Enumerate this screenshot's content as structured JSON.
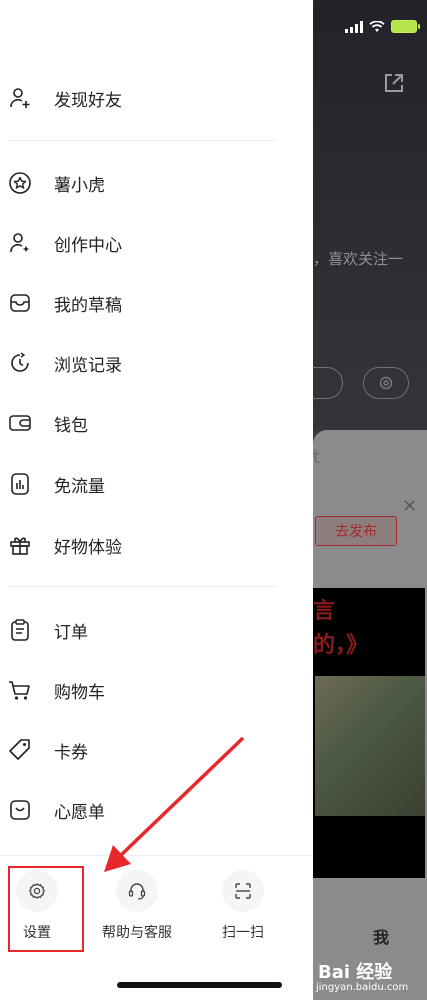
{
  "drawer": {
    "group1": [
      {
        "label": "发现好友",
        "icon": "add-friend-icon"
      }
    ],
    "group2": [
      {
        "label": "薯小虎",
        "icon": "star-badge-icon"
      },
      {
        "label": "创作中心",
        "icon": "creator-icon"
      },
      {
        "label": "我的草稿",
        "icon": "draft-box-icon"
      },
      {
        "label": "浏览记录",
        "icon": "history-clock-icon"
      },
      {
        "label": "钱包",
        "icon": "wallet-icon"
      },
      {
        "label": "免流量",
        "icon": "data-free-icon"
      },
      {
        "label": "好物体验",
        "icon": "gift-icon"
      }
    ],
    "group3": [
      {
        "label": "订单",
        "icon": "order-clipboard-icon"
      },
      {
        "label": "购物车",
        "icon": "cart-icon"
      },
      {
        "label": "卡券",
        "icon": "coupon-tag-icon"
      },
      {
        "label": "心愿单",
        "icon": "wishlist-icon"
      }
    ],
    "bottom": [
      {
        "label": "设置",
        "icon": "gear-icon"
      },
      {
        "label": "帮助与客服",
        "icon": "headset-icon"
      },
      {
        "label": "扫一扫",
        "icon": "scan-icon"
      }
    ]
  },
  "background": {
    "profile_text": "，喜欢关注一",
    "card_text": "t",
    "publish_button": "去发布",
    "video_title_line1": "言",
    "video_title_line2": "的，》",
    "bottom_tab": "我"
  },
  "watermark": {
    "brand": "Bai 经验",
    "url": "jingyan.baidu.com"
  },
  "colors": {
    "highlight": "#e8262b",
    "text": "#222222",
    "divider": "#eeeeee"
  }
}
